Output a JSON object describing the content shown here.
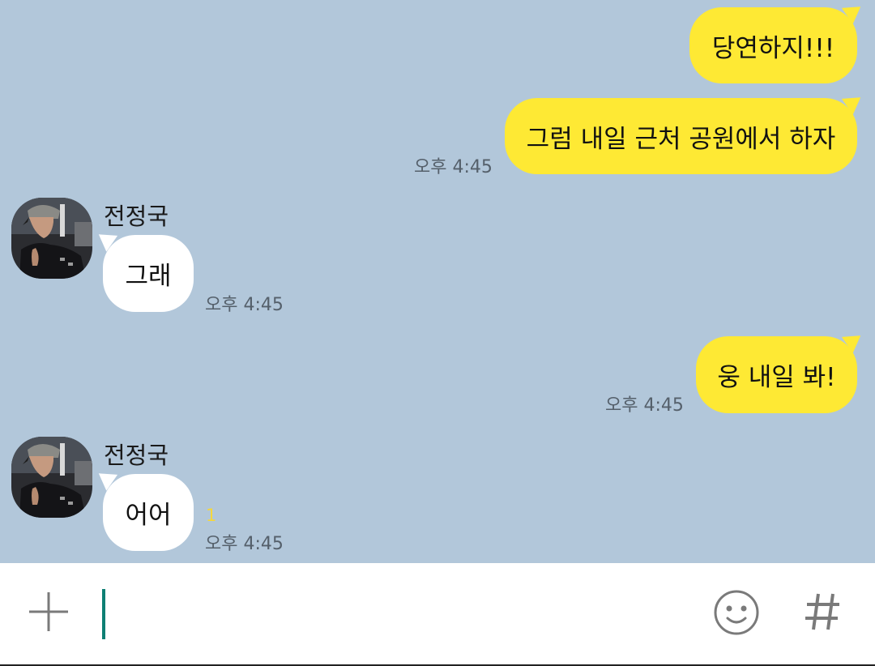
{
  "messages": [
    {
      "from": "me",
      "text": "당연하지!!!"
    },
    {
      "from": "me",
      "text": "그럼 내일 근처 공원에서 하자",
      "time": "오후 4:45"
    },
    {
      "from": "them",
      "sender": "전정국",
      "text": "그래",
      "time": "오후 4:45"
    },
    {
      "from": "me",
      "text": "웅 내일 봐!",
      "time": "오후 4:45"
    },
    {
      "from": "them",
      "sender": "전정국",
      "text": "어어",
      "time": "오후 4:45",
      "unread": "1"
    }
  ],
  "colors": {
    "chat_background": "#b2c7da",
    "my_bubble": "#fee934",
    "their_bubble": "#ffffff",
    "unread_count": "#f5d73b",
    "caret": "#0e7f74"
  },
  "input_bar": {
    "icons": [
      "plus-icon",
      "emoji-icon",
      "hashtag-icon"
    ]
  }
}
